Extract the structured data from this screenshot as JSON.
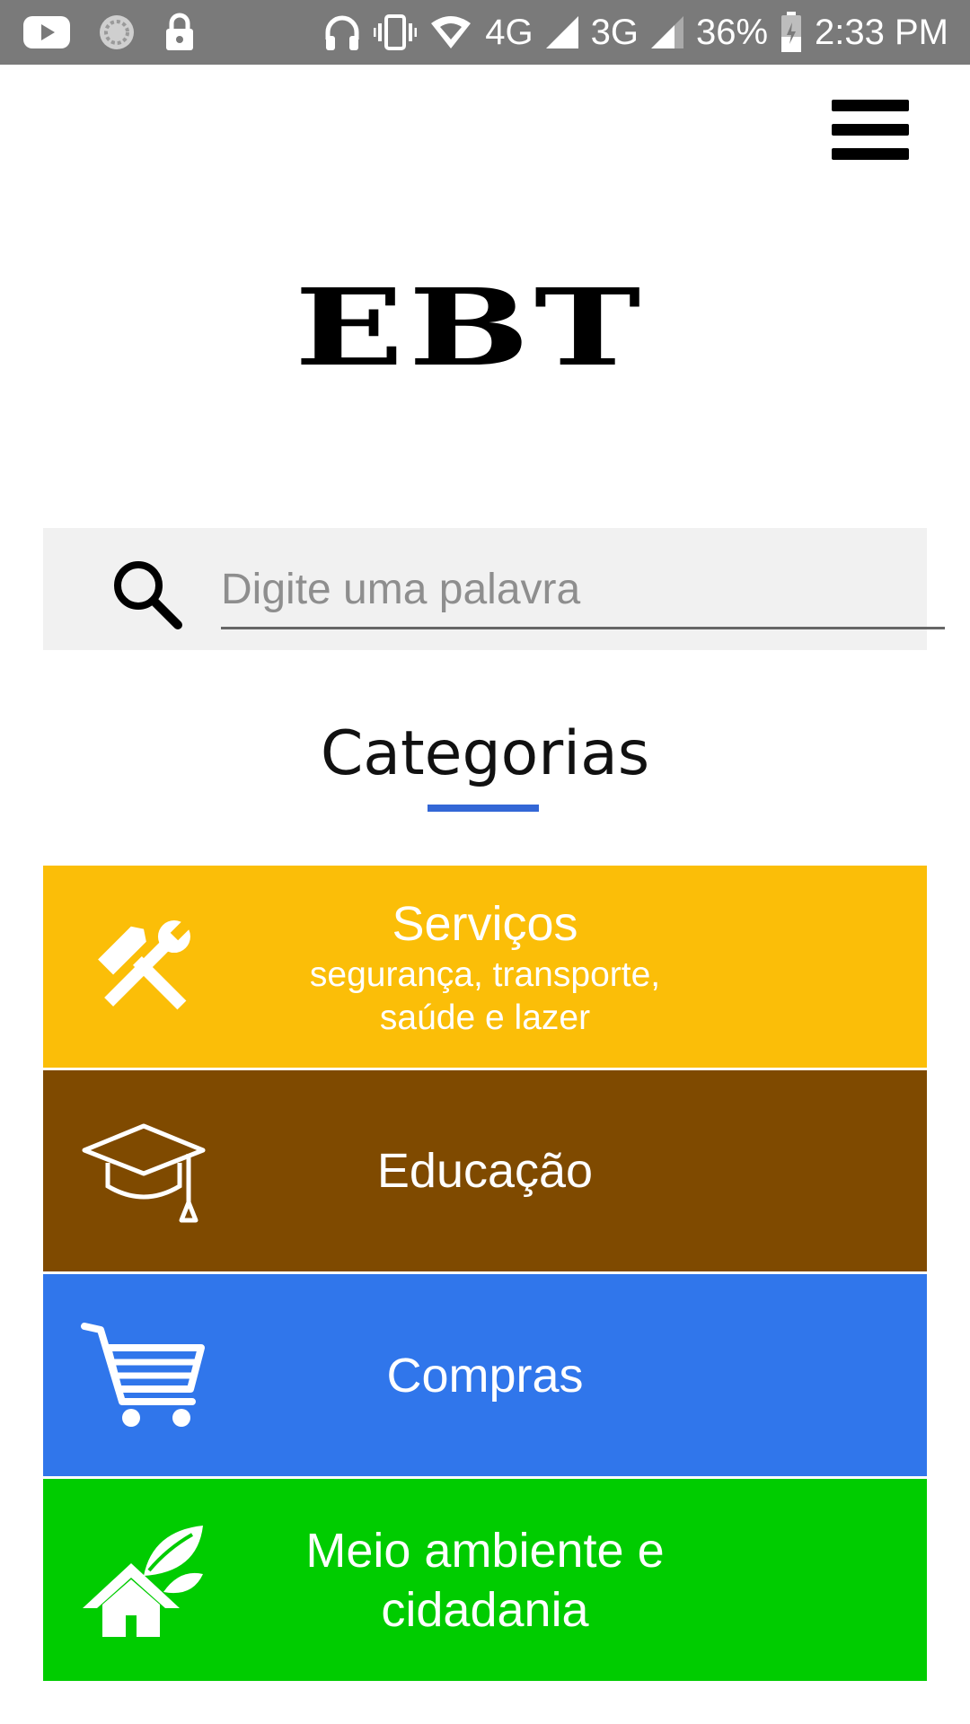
{
  "status_bar": {
    "network_1": "4G",
    "network_2": "3G",
    "battery": "36%",
    "time": "2:33 PM",
    "icons": [
      "youtube-icon",
      "sync-icon",
      "lock-icon",
      "headphones-icon",
      "vibrate-icon",
      "wifi-icon",
      "signal-icon",
      "battery-icon"
    ]
  },
  "header": {
    "logo": "EBT",
    "menu_icon": "hamburger-menu-icon"
  },
  "search": {
    "placeholder": "Digite uma palavra",
    "value": "",
    "icon": "search-icon"
  },
  "categories": {
    "heading": "Categorias",
    "accent_color": "#3367d6",
    "items": [
      {
        "title": "Serviços",
        "subtitle_1": "segurança, transporte,",
        "subtitle_2": "saúde e lazer",
        "color": "#fbbe08",
        "icon": "tools-icon"
      },
      {
        "title": "Educação",
        "color": "#7f4a00",
        "icon": "graduation-cap-icon"
      },
      {
        "title": "Compras",
        "color": "#3076eb",
        "icon": "shopping-cart-icon"
      },
      {
        "title_1": "Meio ambiente e",
        "title_2": "cidadania",
        "color": "#00cc00",
        "icon": "eco-house-icon"
      }
    ]
  }
}
